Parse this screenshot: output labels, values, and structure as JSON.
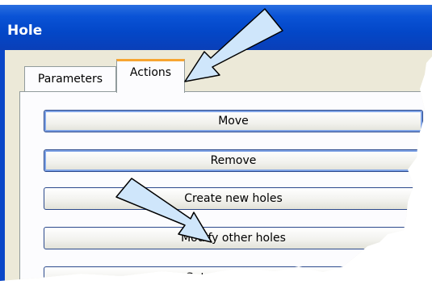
{
  "window": {
    "title": "Hole"
  },
  "tabs": [
    {
      "label": "Parameters"
    },
    {
      "label": "Actions"
    }
  ],
  "actions": [
    {
      "label": "Move"
    },
    {
      "label": "Remove"
    },
    {
      "label": "Create new holes"
    },
    {
      "label": "Modify other holes"
    },
    {
      "label": "Get parameters f"
    }
  ],
  "colors": {
    "titlebar": "#0347c8",
    "tab_highlight": "#f7a532",
    "arrow_fill": "#cfe6fb",
    "button_border": "#2c4a8c"
  },
  "annotations": [
    "arrow-pointing-to-actions-tab",
    "arrow-pointing-to-modify-button"
  ]
}
